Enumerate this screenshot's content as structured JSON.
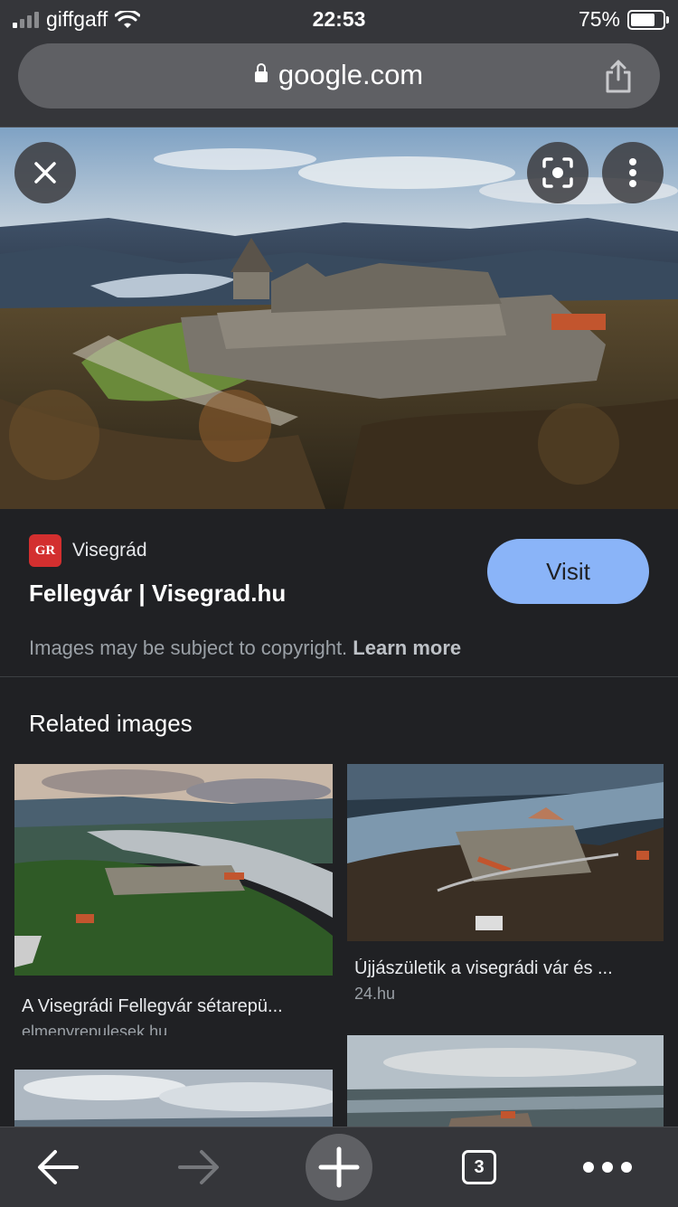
{
  "status_bar": {
    "carrier": "giffgaff",
    "time": "22:53",
    "battery_percent": "75%",
    "battery_level": 0.75,
    "signal_bars": 4,
    "signal_bars_active": 1
  },
  "address_bar": {
    "url": "google.com"
  },
  "hero_image": {
    "description_icon": "castle-photo",
    "close_icon": "close-icon",
    "lens_icon": "lens-icon",
    "menu_icon": "more-vertical-icon"
  },
  "source_info": {
    "site_name": "Visegrád",
    "favicon_text": "GR",
    "page_title": "Fellegvár | Visegrad.hu",
    "visit_label": "Visit",
    "copyright_text": "Images may be subject to copyright.",
    "learn_more": "Learn more"
  },
  "related": {
    "heading": "Related images",
    "items": [
      {
        "caption": "A Visegrádi Fellegvár sétarepü...",
        "domain": "elmenyrepulesek.hu"
      },
      {
        "caption": "Újjászületik a visegrádi vár és ...",
        "domain": "24.hu"
      },
      {
        "caption": "",
        "domain": ""
      },
      {
        "caption": "",
        "domain": ""
      }
    ]
  },
  "bottom_bar": {
    "tab_count": "3",
    "back_icon": "arrow-left-icon",
    "forward_icon": "arrow-right-icon",
    "new_tab_icon": "plus-icon",
    "tabs_icon": "tab-switcher-icon",
    "more_icon": "more-horizontal-icon"
  },
  "colors": {
    "background": "#202124",
    "toolbar": "#35363a",
    "accent": "#8ab4f8",
    "favicon": "#d32f2f"
  }
}
